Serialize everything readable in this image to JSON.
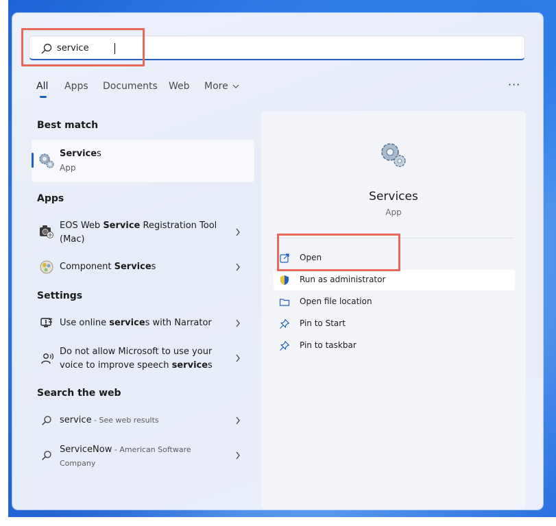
{
  "search": {
    "value": "service"
  },
  "tabs": [
    {
      "label": "All"
    },
    {
      "label": "Apps"
    },
    {
      "label": "Documents"
    },
    {
      "label": "Web"
    },
    {
      "label": "More"
    }
  ],
  "more_menu": "···",
  "best_match": {
    "heading": "Best match",
    "title_bold": "Service",
    "title_rest": "s",
    "subtitle": "App",
    "icon": "gears-icon"
  },
  "apps": {
    "heading": "Apps",
    "items": [
      {
        "pre": "EOS Web ",
        "bold": "Service",
        "post": " Registration Tool",
        "line2": "(Mac)",
        "icon": "camera-app-icon"
      },
      {
        "pre": "Component ",
        "bold": "Service",
        "post": "s",
        "icon": "component-services-icon"
      }
    ]
  },
  "settings": {
    "heading": "Settings",
    "items": [
      {
        "pre": "Use online ",
        "bold": "service",
        "post": "s with Narrator",
        "icon": "narrator-icon"
      },
      {
        "line1": "Do not allow Microsoft to use your",
        "pre": "voice to improve speech ",
        "bold": "service",
        "post": "s",
        "icon": "speech-icon"
      }
    ]
  },
  "web": {
    "heading": "Search the web",
    "items": [
      {
        "main": "service",
        "suffix": " - See web results",
        "icon": "search-icon"
      },
      {
        "main": "ServiceNow",
        "suffix": " - American Software",
        "line2": "Company",
        "icon": "search-icon"
      }
    ]
  },
  "details": {
    "title": "Services",
    "subtitle": "App",
    "icon": "gears-icon",
    "actions": [
      {
        "label": "Open",
        "icon": "open-external-icon"
      },
      {
        "label": "Run as administrator",
        "icon": "shield-icon"
      },
      {
        "label": "Open file location",
        "icon": "folder-icon"
      },
      {
        "label": "Pin to Start",
        "icon": "pin-icon"
      },
      {
        "label": "Pin to taskbar",
        "icon": "pin-icon"
      }
    ]
  },
  "colors": {
    "accent": "#1f5fbf",
    "highlight": "#e8695a"
  }
}
